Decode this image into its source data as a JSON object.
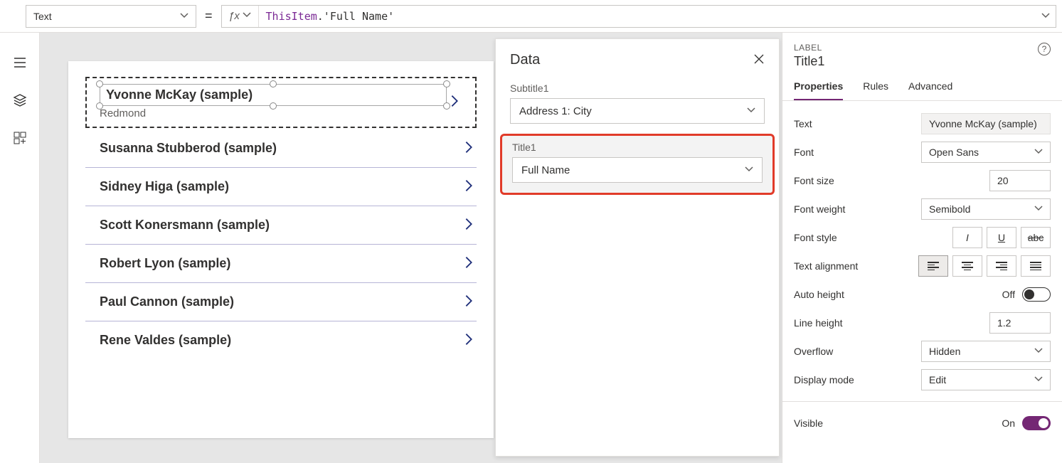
{
  "formula_bar": {
    "property": "Text",
    "equals": "=",
    "fx": "ƒx",
    "expr_kw": "ThisItem",
    "expr_rest": ".'Full Name'"
  },
  "gallery": {
    "selected": {
      "title": "Yvonne McKay (sample)",
      "subtitle": "Redmond"
    },
    "items": [
      "Susanna Stubberod (sample)",
      "Sidney Higa (sample)",
      "Scott Konersmann (sample)",
      "Robert Lyon (sample)",
      "Paul Cannon (sample)",
      "Rene Valdes (sample)"
    ]
  },
  "data_pane": {
    "title": "Data",
    "subtitle_label": "Subtitle1",
    "subtitle_value": "Address 1: City",
    "title_label": "Title1",
    "title_value": "Full Name"
  },
  "props": {
    "type": "LABEL",
    "name": "Title1",
    "tabs": {
      "properties": "Properties",
      "rules": "Rules",
      "advanced": "Advanced"
    },
    "text_lbl": "Text",
    "text_val": "Yvonne McKay (sample)",
    "font_lbl": "Font",
    "font_val": "Open Sans",
    "fontsize_lbl": "Font size",
    "fontsize_val": "20",
    "fontweight_lbl": "Font weight",
    "fontweight_val": "Semibold",
    "fontstyle_lbl": "Font style",
    "align_lbl": "Text alignment",
    "autoheight_lbl": "Auto height",
    "autoheight_state": "Off",
    "lineheight_lbl": "Line height",
    "lineheight_val": "1.2",
    "overflow_lbl": "Overflow",
    "overflow_val": "Hidden",
    "display_lbl": "Display mode",
    "display_val": "Edit",
    "visible_lbl": "Visible",
    "visible_state": "On"
  }
}
